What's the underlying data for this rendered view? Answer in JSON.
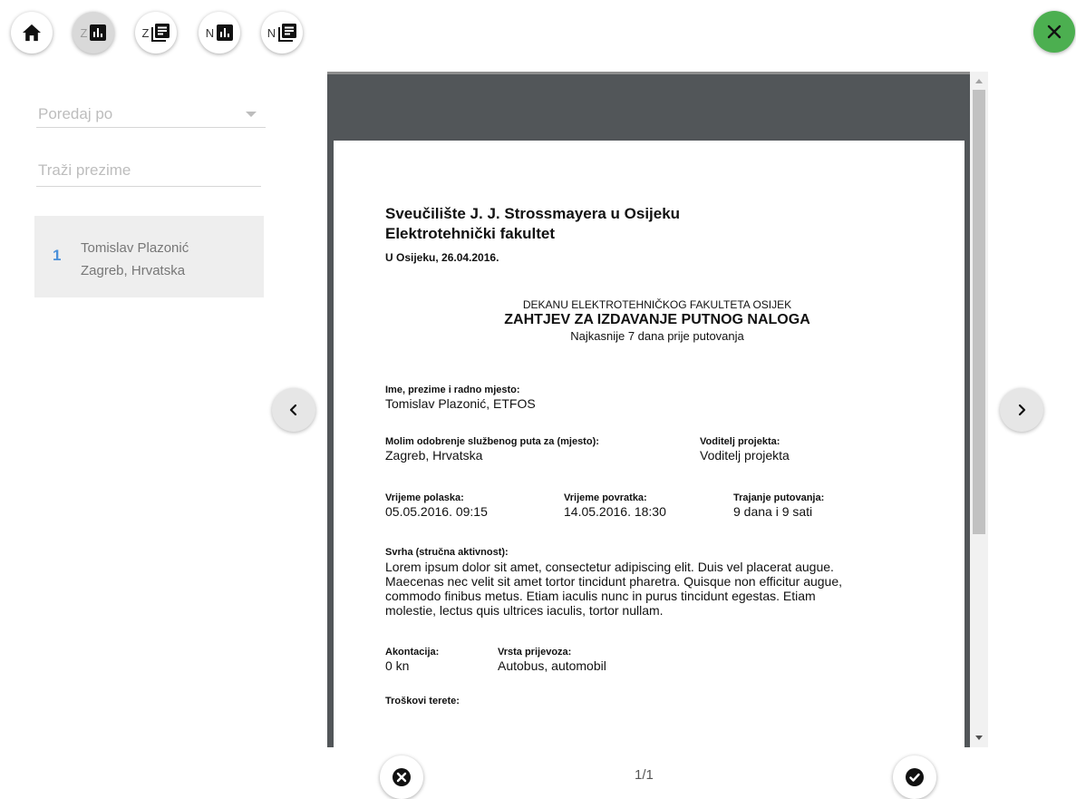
{
  "toolbar": {
    "home_icon": "home-icon",
    "z_letter": "Z",
    "n_letter": "N",
    "chart_icon": "bar-chart-icon",
    "doc_icon": "document-list-icon",
    "close_icon": "close-icon",
    "colors": {
      "close_bg": "#4caf50",
      "active_bg": "#d9d9d9"
    }
  },
  "sidebar": {
    "sort_placeholder": "Poredaj po",
    "search_placeholder": "Traži prezime",
    "items": [
      {
        "index": "1",
        "name": "Tomislav Plazonić",
        "location": "Zagreb, Hrvatska"
      }
    ]
  },
  "document": {
    "institution_line1": "Sveučilište J. J. Strossmayera u Osijeku",
    "institution_line2": "Elektrotehnički fakultet",
    "date_line": "U Osijeku, 26.04.2016.",
    "addressee": "DEKANU ELEKTROTEHNIČKOG FAKULTETA OSIJEK",
    "title": "ZAHTJEV ZA IZDAVANJE PUTNOG NALOGA",
    "subtitle": "Najkasnije 7 dana prije putovanja",
    "fields": {
      "name_label": "Ime, prezime i radno mjesto:",
      "name_value": "Tomislav Plazonić, ETFOS",
      "destination_label": "Molim odobrenje službenog puta za (mjesto):",
      "destination_value": "Zagreb, Hrvatska",
      "leader_label": "Voditelj projekta:",
      "leader_value": "Voditelj projekta",
      "departure_label": "Vrijeme polaska:",
      "departure_value": "05.05.2016. 09:15",
      "return_label": "Vrijeme povratka:",
      "return_value": "14.05.2016. 18:30",
      "duration_label": "Trajanje putovanja:",
      "duration_value": "9 dana i 9 sati",
      "purpose_label": "Svrha (stručna aktivnost):",
      "purpose_lines": [
        "Lorem ipsum dolor sit amet, consectetur adipiscing elit. Duis vel placerat augue.",
        "Maecenas nec velit sit amet tortor tincidunt pharetra. Quisque non efficitur augue,",
        "commodo finibus metus. Etiam iaculis nunc in purus tincidunt egestas. Etiam",
        "molestie, lectus quis ultrices iaculis, tortor nullam."
      ],
      "advance_label": "Akontacija:",
      "advance_value": "0 kn",
      "transport_label": "Vrsta prijevoza:",
      "transport_value": "Autobus, automobil",
      "costs_label": "Troškovi terete:"
    }
  },
  "viewer": {
    "prev_icon": "chevron-left-icon",
    "next_icon": "chevron-right-icon",
    "pager": "1/1",
    "reject_icon": "cancel-circle-icon",
    "accept_icon": "check-circle-icon"
  }
}
